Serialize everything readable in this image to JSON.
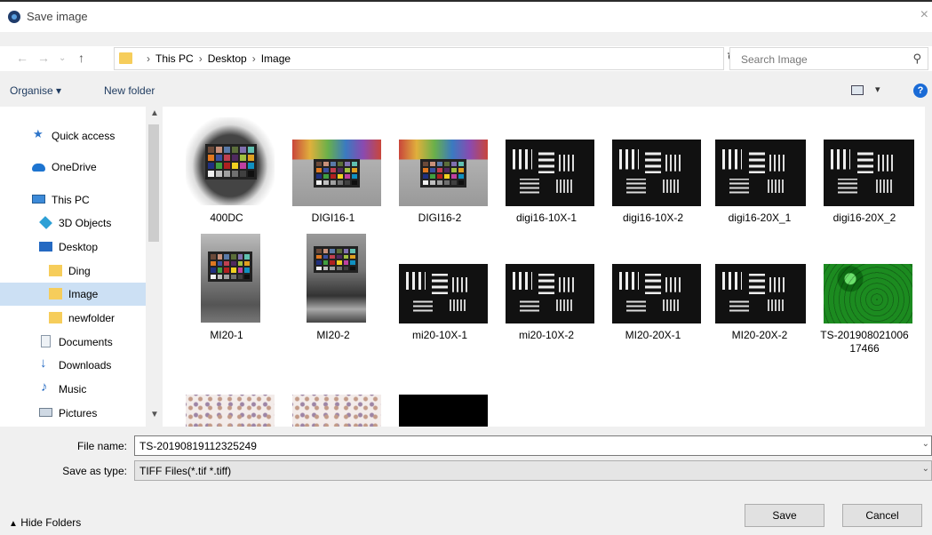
{
  "window": {
    "title": "Save image",
    "close_label": "×"
  },
  "address": {
    "crumbs": [
      "This PC",
      "Desktop",
      "Image"
    ],
    "separator": "›",
    "search_placeholder": "Search Image"
  },
  "toolbar": {
    "organise_label": "Organise ▾",
    "new_folder_label": "New folder",
    "help_label": "?"
  },
  "sidebar": {
    "items": [
      {
        "label": "Quick access",
        "icon": "star-icon"
      },
      {
        "label": "OneDrive",
        "icon": "cloud-icon"
      },
      {
        "label": "This PC",
        "icon": "computer-icon"
      },
      {
        "label": "3D Objects",
        "icon": "cube-icon"
      },
      {
        "label": "Desktop",
        "icon": "desktop-icon"
      },
      {
        "label": "Ding",
        "icon": "folder-icon"
      },
      {
        "label": "Image",
        "icon": "folder-icon",
        "selected": true
      },
      {
        "label": "newfolder",
        "icon": "folder-icon"
      },
      {
        "label": "Documents",
        "icon": "document-icon"
      },
      {
        "label": "Downloads",
        "icon": "download-icon"
      },
      {
        "label": "Music",
        "icon": "music-icon"
      },
      {
        "label": "Pictures",
        "icon": "pictures-icon"
      }
    ]
  },
  "files": [
    {
      "name": "400DC"
    },
    {
      "name": "DIGI16-1"
    },
    {
      "name": "DIGI16-2"
    },
    {
      "name": "digi16-10X-1"
    },
    {
      "name": "digi16-10X-2"
    },
    {
      "name": "digi16-20X_1"
    },
    {
      "name": "digi16-20X_2"
    },
    {
      "name": "MI20-1"
    },
    {
      "name": "MI20-2"
    },
    {
      "name": "mi20-10X-1"
    },
    {
      "name": "mi20-10X-2"
    },
    {
      "name": "MI20-20X-1"
    },
    {
      "name": "MI20-20X-2"
    },
    {
      "name": "TS-201908021006\n17466"
    },
    {
      "name": ""
    },
    {
      "name": ""
    },
    {
      "name": ""
    }
  ],
  "form": {
    "file_name_label": "File name:",
    "file_name_value": "TS-20190819112325249",
    "save_type_label": "Save as type:",
    "save_type_value": "TIFF Files(*.tif *.tiff)"
  },
  "footer": {
    "hide_folders_label": "Hide Folders",
    "save_label": "Save",
    "cancel_label": "Cancel"
  }
}
